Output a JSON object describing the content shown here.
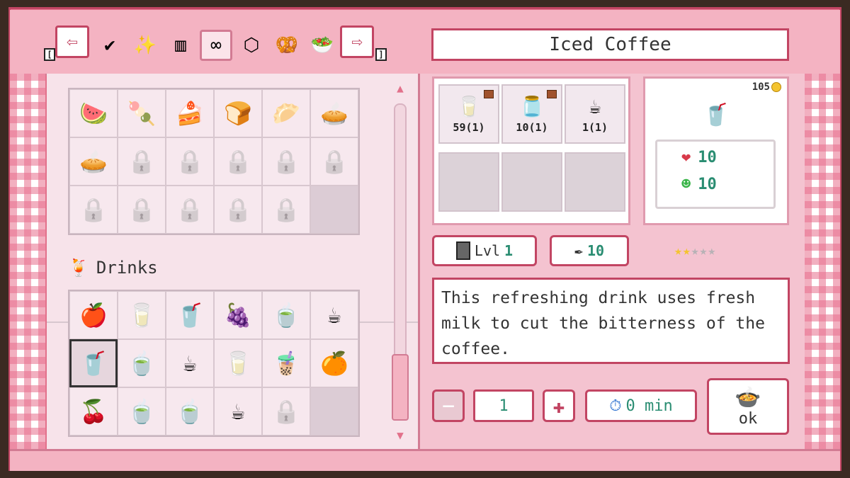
{
  "window": {
    "recipe_title": "Iced Coffee"
  },
  "nav": {
    "prev_arrow": "⇦",
    "next_arrow": "⇨",
    "prev_key": "[",
    "next_key": "]",
    "category_tabs": [
      {
        "icon": "checkmark-icon",
        "glyph": "✔"
      },
      {
        "icon": "sparkle-icon",
        "glyph": "✨"
      },
      {
        "icon": "cooking-station-icon",
        "glyph": "▥"
      },
      {
        "icon": "infinity-icon",
        "glyph": "∞",
        "active": true
      },
      {
        "icon": "mixer-icon",
        "glyph": "⬡"
      },
      {
        "icon": "pretzel-icon",
        "glyph": "🥨"
      },
      {
        "icon": "salad-icon",
        "glyph": "🥗"
      }
    ]
  },
  "food_grid": {
    "rows": [
      [
        "🍉",
        "🍡",
        "🍰",
        "🍞",
        "🥟",
        "🥧"
      ],
      [
        "🥧",
        "lock",
        "lock",
        "lock",
        "lock",
        "lock"
      ],
      [
        "lock",
        "lock",
        "lock",
        "lock",
        "lock",
        "empty"
      ]
    ]
  },
  "drinks": {
    "header_icon": "🍹",
    "header_label": "Drinks",
    "rows": [
      [
        "🍎",
        "🥛",
        "🥤",
        "🍇",
        "🍵",
        "☕"
      ],
      [
        "🥤",
        "🍵",
        "☕",
        "🥛",
        "🧋",
        "🍊"
      ],
      [
        "🍒",
        "🍵",
        "🍵",
        "☕",
        "lock",
        "empty"
      ]
    ],
    "selected_index": [
      1,
      0
    ]
  },
  "ingredients": [
    {
      "icon": "milk-bottle-icon",
      "glyph": "🥛",
      "amount": "59(1)",
      "chest": true
    },
    {
      "icon": "water-jug-icon",
      "glyph": "🫙",
      "amount": "10(1)",
      "chest": true
    },
    {
      "icon": "coffee-cup-icon",
      "glyph": "☕",
      "amount": "1(1)",
      "chest": false
    }
  ],
  "stats": {
    "price": "105",
    "dish_glyph": "🥤",
    "heart_value": "10",
    "energy_value": "10",
    "heart_glyph": "❤",
    "energy_glyph": "☻"
  },
  "station": {
    "icon": "cooking-station-icon",
    "label": "Lvl",
    "level": "1"
  },
  "ingredient_count": {
    "icon": "feather-icon",
    "glyph": "✒",
    "value": "10"
  },
  "rating": {
    "filled": 2,
    "total": 5
  },
  "description": "This refreshing drink uses fresh milk to cut the bitterness of the coffee.",
  "controls": {
    "minus": "−",
    "quantity": "1",
    "plus": "✚",
    "time_icon": "⏱",
    "time_label": "0 min",
    "ok_icon": "🍲",
    "ok_label": "ok"
  },
  "scroll": {
    "up": "▲",
    "down": "▼"
  },
  "colors": {
    "accent": "#e3718b",
    "panel": "#f7e3ea",
    "green_text": "#2a8d72"
  }
}
